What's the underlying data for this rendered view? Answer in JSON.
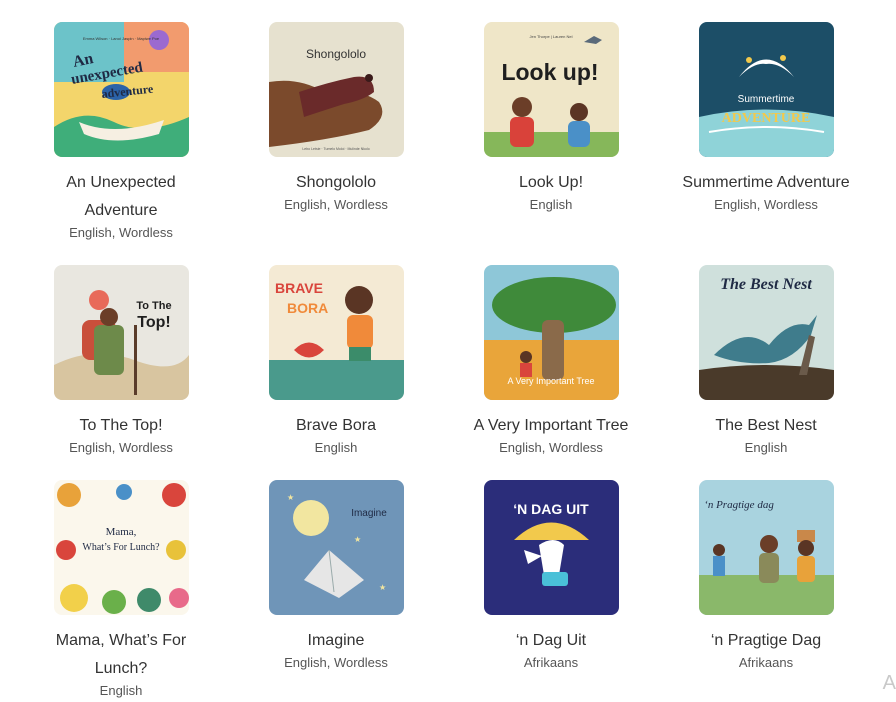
{
  "books": [
    {
      "title": "An Unexpected Adventure",
      "languages": "English, Wordless",
      "cover_icon": "an-unexpected-adventure-cover",
      "cover_texts": [
        "Emma Wilson · Lanoi Jaspin · Mapiwe Poe",
        "An",
        "unexpected",
        "adventure"
      ]
    },
    {
      "title": "Shongololo",
      "languages": "English, Wordless",
      "cover_icon": "shongololo-cover",
      "cover_texts": [
        "Shongololo",
        "Lebo Letsie · Tumelo Moloi · Mulinde Nkolo"
      ]
    },
    {
      "title": "Look Up!",
      "languages": "English",
      "cover_icon": "look-up-cover",
      "cover_texts": [
        "Jen Thorpe | Lauren Nel",
        "Look up!"
      ]
    },
    {
      "title": "Summertime Adventure",
      "languages": "English, Wordless",
      "cover_icon": "summertime-adventure-cover",
      "cover_texts": [
        "Summertime",
        "ADVENTURE"
      ]
    },
    {
      "title": "To The Top!",
      "languages": "English, Wordless",
      "cover_icon": "to-the-top-cover",
      "cover_texts": [
        "To The",
        "Top!"
      ]
    },
    {
      "title": "Brave Bora",
      "languages": "English",
      "cover_icon": "brave-bora-cover",
      "cover_texts": [
        "BRAVE",
        "BORA"
      ]
    },
    {
      "title": "A Very Important Tree",
      "languages": "English, Wordless",
      "cover_icon": "a-very-important-tree-cover",
      "cover_texts": [
        "A Very Important Tree"
      ]
    },
    {
      "title": "The Best Nest",
      "languages": "English",
      "cover_icon": "the-best-nest-cover",
      "cover_texts": [
        "The Best Nest"
      ]
    },
    {
      "title": "Mama, What’s For Lunch?",
      "languages": "English",
      "cover_icon": "mama-whats-for-lunch-cover",
      "cover_texts": [
        "Mama,",
        "What’s For Lunch?"
      ]
    },
    {
      "title": "Imagine",
      "languages": "English, Wordless",
      "cover_icon": "imagine-cover",
      "cover_texts": [
        "Imagine"
      ]
    },
    {
      "title": "‘n Dag Uit",
      "languages": "Afrikaans",
      "cover_icon": "n-dag-uit-cover",
      "cover_texts": [
        "‘N DAG UIT"
      ]
    },
    {
      "title": "‘n Pragtige Dag",
      "languages": "Afrikaans",
      "cover_icon": "n-pragtige-dag-cover",
      "cover_texts": [
        "‘n Pragtige dag"
      ]
    }
  ],
  "corner_letter": "A"
}
